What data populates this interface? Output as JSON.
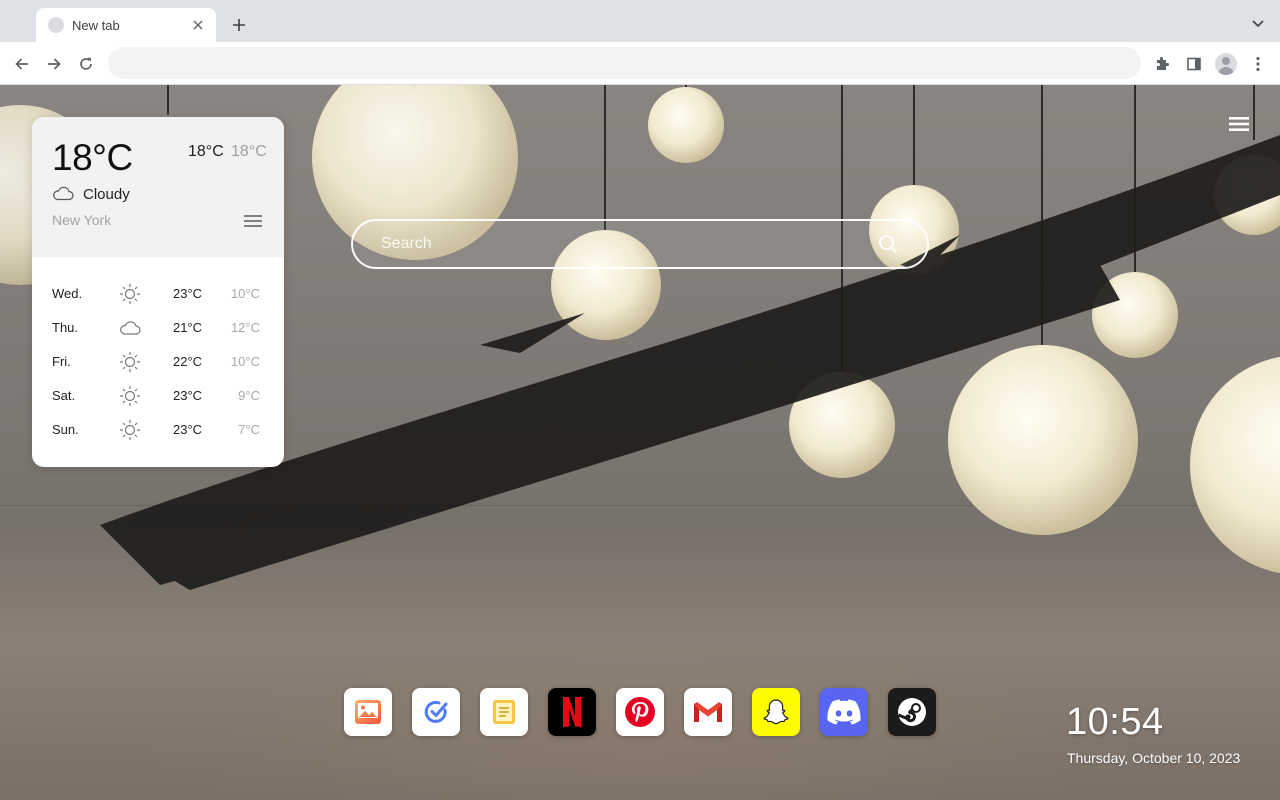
{
  "browser": {
    "tab": {
      "title": "New tab",
      "close_icon": "close-icon",
      "favicon": "globe-icon"
    },
    "new_tab_icon": "plus-icon",
    "tab_search_icon": "chevron-down-icon",
    "toolbar": {
      "back_icon": "back-arrow-icon",
      "forward_icon": "forward-arrow-icon",
      "reload_icon": "reload-icon",
      "address_value": "",
      "extensions_icon": "puzzle-icon",
      "side_panel_icon": "side-panel-icon",
      "profile_icon": "avatar-icon",
      "menu_icon": "kebab-menu-icon"
    }
  },
  "weather": {
    "current_temp": "18°C",
    "high": "18°C",
    "low": "18°C",
    "condition": "Cloudy",
    "condition_icon": "cloud-icon",
    "city": "New York",
    "menu_icon": "hamburger-icon",
    "forecast": [
      {
        "day": "Wed.",
        "icon": "sun-icon",
        "high": "23°C",
        "low": "10°C"
      },
      {
        "day": "Thu.",
        "icon": "cloud-icon",
        "high": "21°C",
        "low": "12°C"
      },
      {
        "day": "Fri.",
        "icon": "sun-icon",
        "high": "22°C",
        "low": "10°C"
      },
      {
        "day": "Sat.",
        "icon": "sun-icon",
        "high": "23°C",
        "low": "9°C"
      },
      {
        "day": "Sun.",
        "icon": "sun-icon",
        "high": "23°C",
        "low": "7°C"
      }
    ]
  },
  "search": {
    "placeholder": "Search",
    "icon": "search-icon"
  },
  "page_menu_icon": "hamburger-icon",
  "dock": [
    {
      "name": "photos",
      "icon": "image-icon",
      "bg": "#ffffff"
    },
    {
      "name": "tasks",
      "icon": "check-circle-icon",
      "bg": "#ffffff"
    },
    {
      "name": "notes",
      "icon": "note-icon",
      "bg": "#ffffff"
    },
    {
      "name": "netflix",
      "icon": "netflix-icon",
      "bg": "#000000"
    },
    {
      "name": "pinterest",
      "icon": "pinterest-icon",
      "bg": "#ffffff"
    },
    {
      "name": "gmail",
      "icon": "gmail-icon",
      "bg": "#ffffff"
    },
    {
      "name": "snapchat",
      "icon": "snapchat-icon",
      "bg": "#fffc00"
    },
    {
      "name": "discord",
      "icon": "discord-icon",
      "bg": "#5865f2"
    },
    {
      "name": "steam",
      "icon": "steam-icon",
      "bg": "#1b1b1b"
    }
  ],
  "clock": {
    "time": "10:54",
    "date": "Thursday, October 10, 2023"
  }
}
